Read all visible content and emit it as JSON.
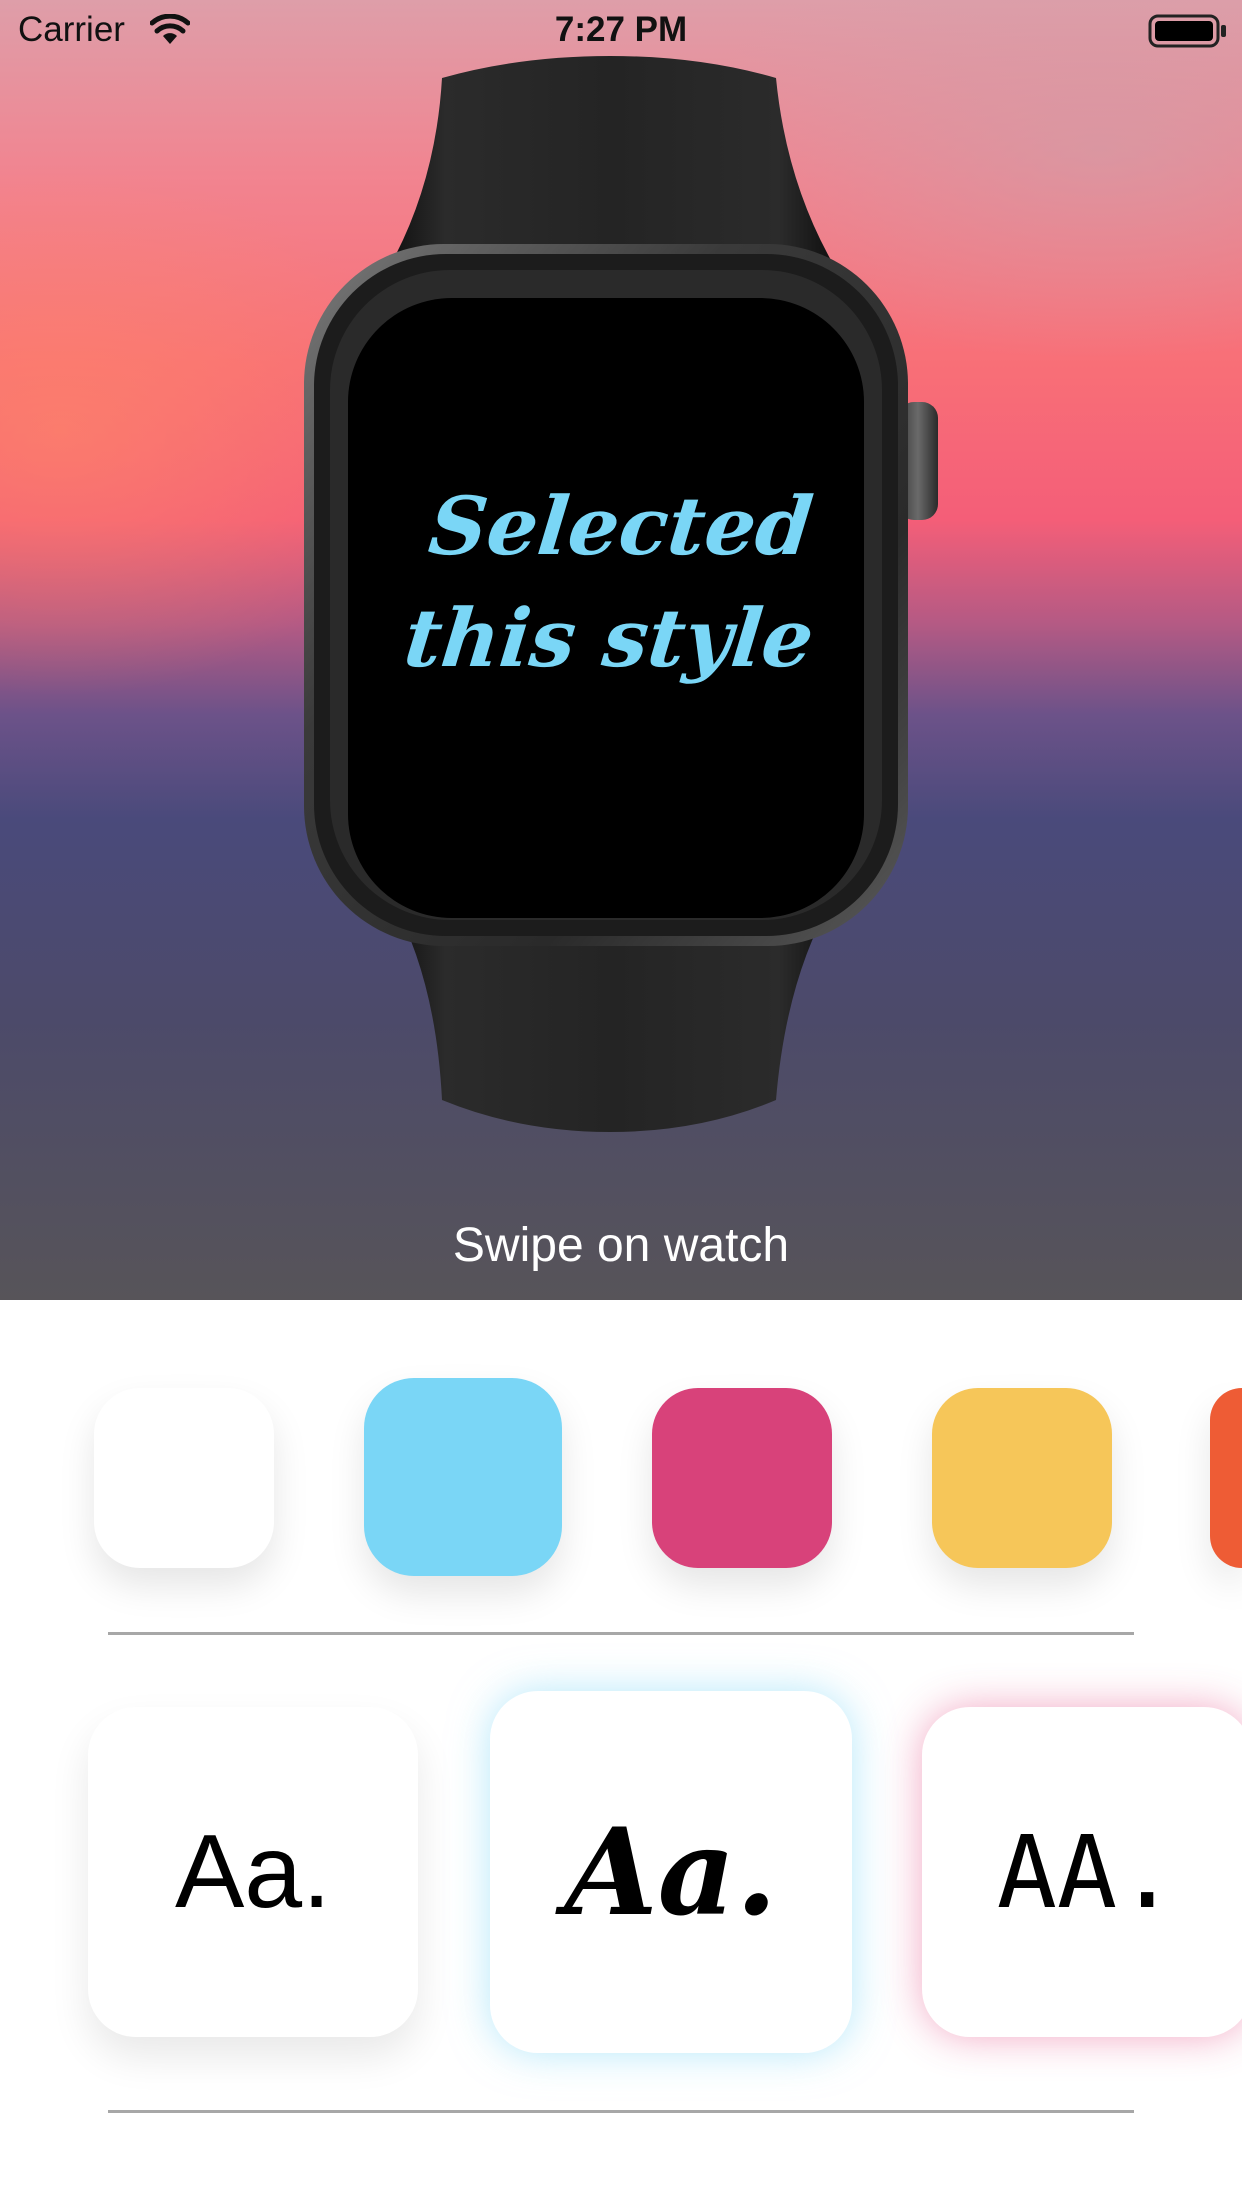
{
  "status_bar": {
    "carrier": "Carrier",
    "time": "7:27 PM"
  },
  "watch": {
    "screen_text_line1": "Selected",
    "screen_text_line2": "this style"
  },
  "hint": "Swipe on watch",
  "colors": [
    {
      "name": "white",
      "hex": "#ffffff",
      "selected": false
    },
    {
      "name": "light-blue",
      "hex": "#7ad6f6",
      "selected": true
    },
    {
      "name": "pink",
      "hex": "#d8427a",
      "selected": false
    },
    {
      "name": "yellow",
      "hex": "#f6c659",
      "selected": false
    },
    {
      "name": "orange",
      "hex": "#ee5c35",
      "selected": false
    }
  ],
  "fonts": [
    {
      "sample": "Aa.",
      "style": "sans-serif",
      "selected": false
    },
    {
      "sample": "Aa.",
      "style": "script",
      "selected": true
    },
    {
      "sample": "AA.",
      "style": "hand-caps",
      "selected": false
    }
  ]
}
